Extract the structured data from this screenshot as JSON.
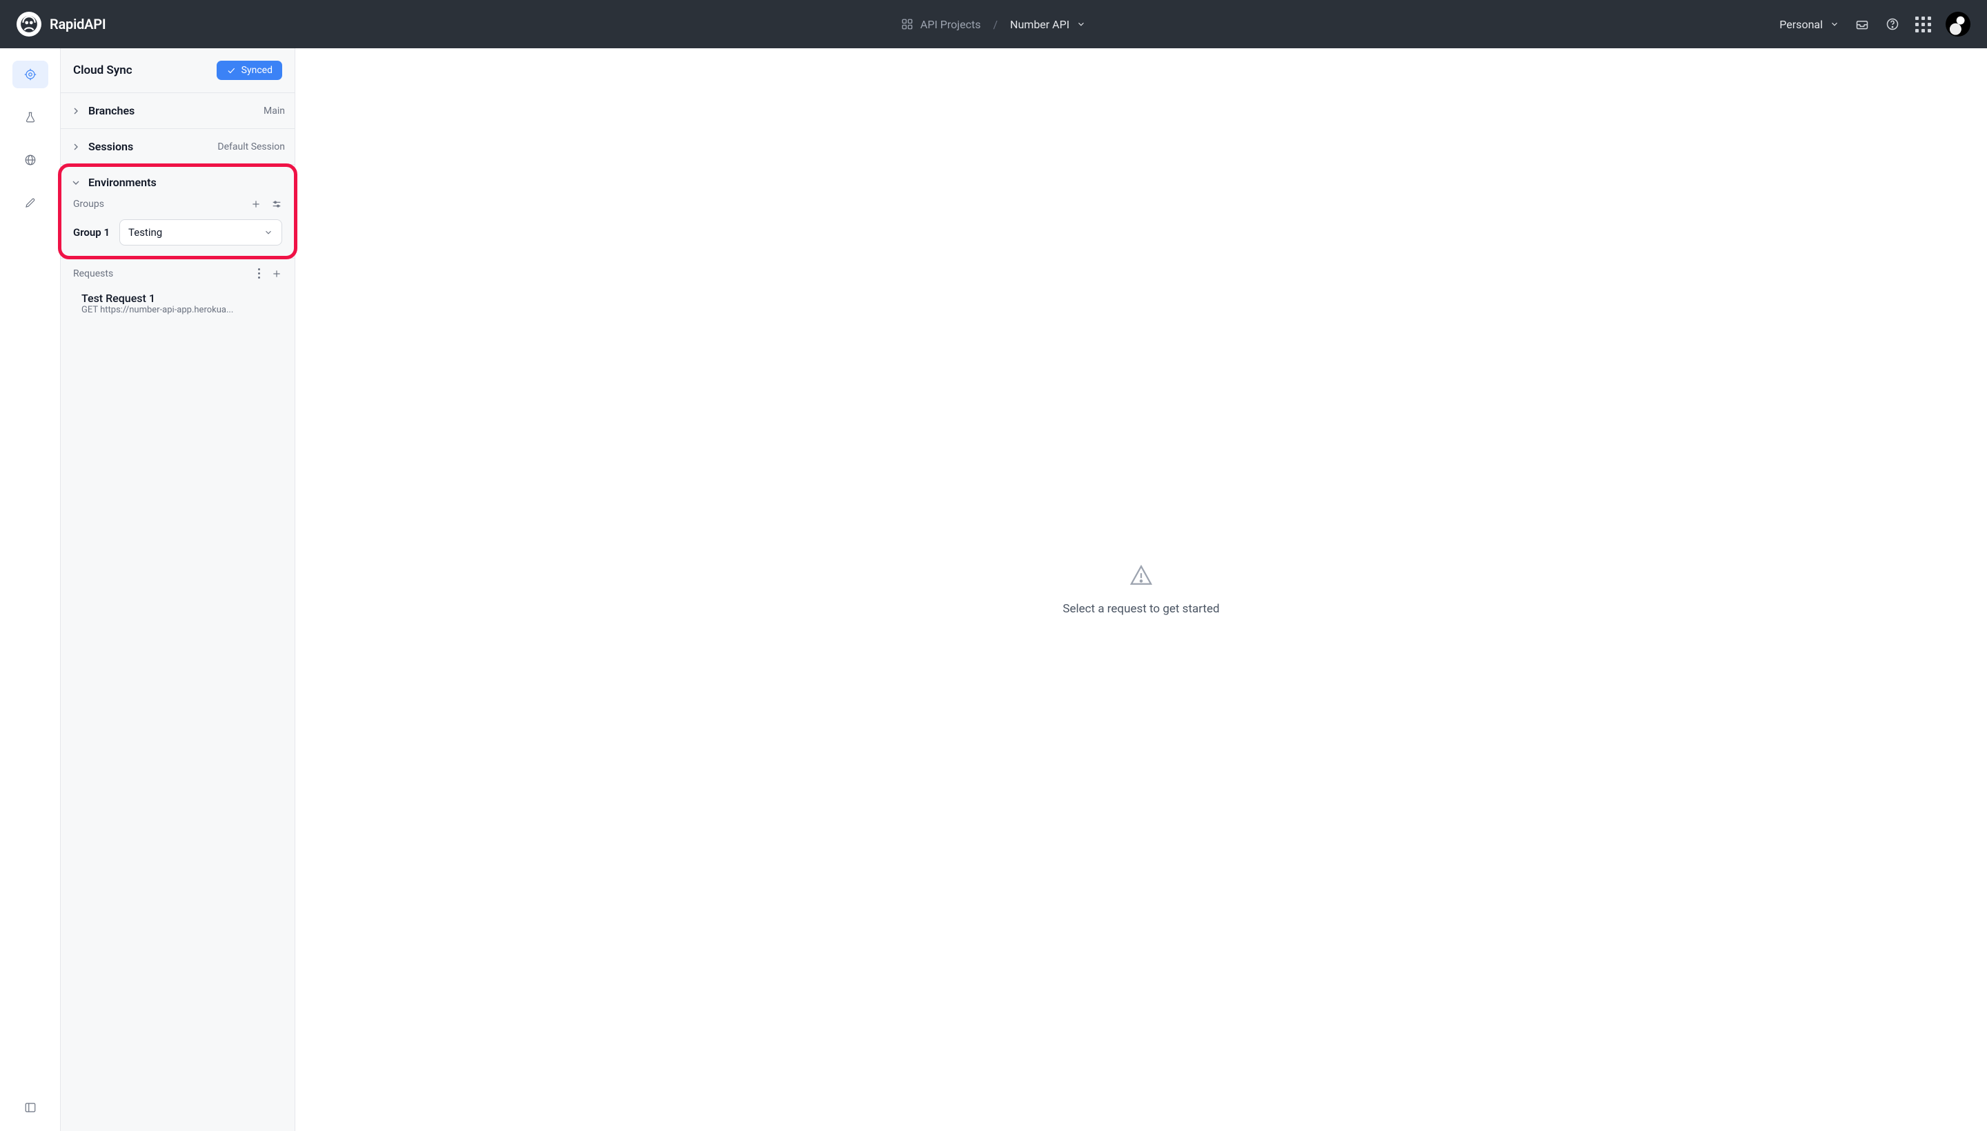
{
  "header": {
    "brand": "RapidAPI",
    "projects_link": "API Projects",
    "breadcrumb_sep": "/",
    "current_project": "Number API",
    "workspace": "Personal"
  },
  "sidebar": {
    "cloud_sync_title": "Cloud Sync",
    "synced_label": "Synced",
    "branches_label": "Branches",
    "branches_value": "Main",
    "sessions_label": "Sessions",
    "sessions_value": "Default Session",
    "environments_label": "Environments",
    "groups_label": "Groups",
    "group_name": "Group 1",
    "group_selected_env": "Testing",
    "requests_label": "Requests",
    "requests": [
      {
        "name": "Test Request 1",
        "url": "GET https://number-api-app.herokua..."
      }
    ]
  },
  "main": {
    "empty_prompt": "Select a request to get started"
  }
}
